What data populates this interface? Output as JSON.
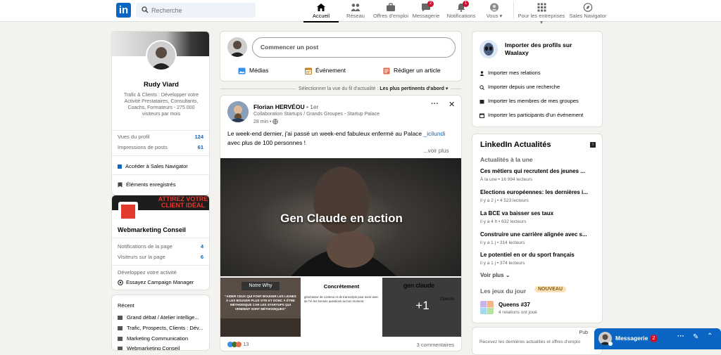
{
  "header": {
    "logo_text": "in",
    "search_placeholder": "Recherche",
    "nav": [
      {
        "label": "Accueil",
        "icon": "home-icon"
      },
      {
        "label": "Réseau",
        "icon": "network-icon"
      },
      {
        "label": "Offres d'emploi",
        "icon": "briefcase-icon"
      },
      {
        "label": "Messagerie",
        "icon": "message-icon",
        "badge": "2"
      },
      {
        "label": "Notifications",
        "icon": "bell-icon",
        "badge": "1"
      },
      {
        "label": "Vous",
        "icon": "avatar-icon"
      },
      {
        "label": "Pour les entreprises",
        "icon": "grid-icon"
      },
      {
        "label": "Sales Navigator",
        "icon": "compass-icon"
      }
    ]
  },
  "profile": {
    "name": "Rudy Viard",
    "headline": "Trafic & Clients : Développer votre Activité Prestataires, Consultants, Coachs, Formateurs - 275 000 visiteurs par mois",
    "stats": [
      {
        "label": "Vues du profil",
        "value": "124"
      },
      {
        "label": "Impressions de posts",
        "value": "61"
      }
    ],
    "sales_nav": "Accéder à Sales Navigator",
    "saved": "Éléments enregistrés"
  },
  "page_card": {
    "banner_text": "ATTIREZ VOTRE CLIENT IDÉAL",
    "name": "Webmarketing Conseil",
    "stats": [
      {
        "label": "Notifications de la page",
        "value": "4"
      },
      {
        "label": "Visiteurs sur la page",
        "value": "6"
      }
    ],
    "grow": "Développez votre activité",
    "campaign": "Essayez Campaign Manager"
  },
  "recent": {
    "title": "Récent",
    "items": [
      "Grand débat / Atelier intellige...",
      "Trafic, Prospects, Clients : Dév...",
      "Marketing Communication",
      "Webmarketing Conseil"
    ]
  },
  "composer": {
    "placeholder": "Commencer un post",
    "actions": [
      {
        "label": "Médias",
        "color": "#378fe9"
      },
      {
        "label": "Événement",
        "color": "#c37d16"
      },
      {
        "label": "Rédiger un article",
        "color": "#e06847"
      }
    ]
  },
  "feed_sort": {
    "label": "Sélectionner la vue du fil d'actualité :",
    "value": "Les plus pertinents d'abord"
  },
  "post": {
    "author": "Florian HERVÉOU",
    "degree": "• 1er",
    "subtitle": "Collaboration Startups / Grands Groupes - Startup Palace",
    "time": "28 min •",
    "text_before": "Le week-end dernier, j'ai passé un week-end fabuleux enfermé au Palace ",
    "hashtag": "_icilundi",
    "text_after": "avec plus de 100 personnes !",
    "see_more": "...voir plus",
    "image_title": "Gen Claude en action",
    "thumb1_title": "Notre Why",
    "thumb1_text": "\"AIDER CEUX QUI FONT BOUGER LES LIGNES À LES BOUGER PLUS VITE ET DONC À ÊTRE MÉTHODIQUE CAR LES STARTUPS QUI VENDENT SONT MÉTHODIQUES\"",
    "thumb2_title": "Concrètement",
    "thumb2_text": "générateur de contenu et de transcripts pour avoir avec de l'IA les bonnes questions au bon moment.",
    "thumb3_title": "gen claude",
    "thumb3_side": "OpenAI",
    "thumb3_more": "+1",
    "reactions": "13",
    "comments": "3 commentaires"
  },
  "waalaxy": {
    "title": "Importer des profils sur Waalaxy",
    "items": [
      "Importer mes relations",
      "Importer depuis une recherche",
      "Importer les membres de mes groupes",
      "Importer les participants d'un événement"
    ]
  },
  "news": {
    "title": "LinkedIn Actualités",
    "subtitle": "Actualités à la une",
    "items": [
      {
        "title": "Ces métiers qui recrutent des jeunes ...",
        "meta": "À la une • 16 994 lecteurs"
      },
      {
        "title": "Elections européennes: les dernières i...",
        "meta": "il y a 2 j • 4 523 lecteurs"
      },
      {
        "title": "La BCE va baisser ses taux",
        "meta": "il y a 4 h • 632 lecteurs"
      },
      {
        "title": "Construire une carrière alignée avec s...",
        "meta": "il y a 1 j • 314 lecteurs"
      },
      {
        "title": "Le potentiel en or du sport français",
        "meta": "il y a 1 j • 374 lecteurs"
      }
    ],
    "more": "Voir plus",
    "games_title": "Les jeux du jour",
    "games_badge": "NOUVEAU",
    "game_name": "Queens #37",
    "game_meta": "4 relations ont joué"
  },
  "ad": {
    "label": "Pub",
    "text": "Recevez les dernières actualités et offres d'emplo"
  },
  "messaging": {
    "label": "Messagerie",
    "badge": "2"
  }
}
